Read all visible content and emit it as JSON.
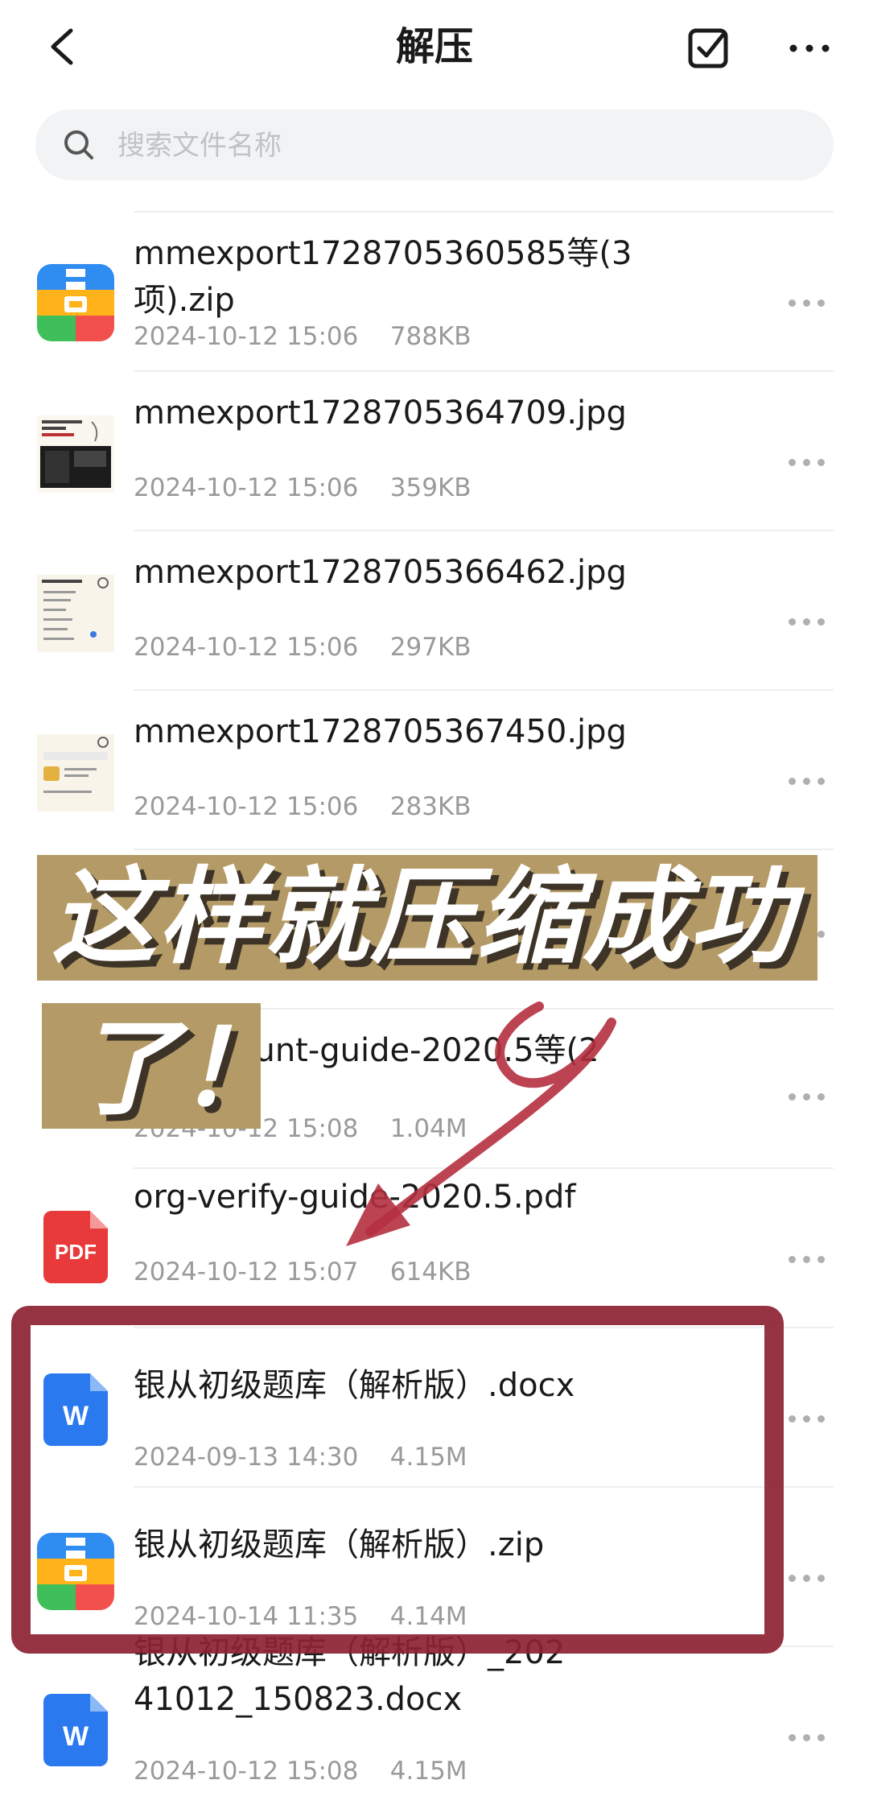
{
  "header": {
    "title": "解压"
  },
  "search": {
    "placeholder": "搜索文件名称"
  },
  "files": [
    {
      "name": "mmexport1728705360585等(3项).zip",
      "date": "2024-10-12 15:06",
      "size": "788KB",
      "icon": "zip-icon"
    },
    {
      "name": "mmexport1728705364709.jpg",
      "date": "2024-10-12 15:06",
      "size": "359KB",
      "icon": "image-thumbnail"
    },
    {
      "name": "mmexport1728705366462.jpg",
      "date": "2024-10-12 15:06",
      "size": "297KB",
      "icon": "image-thumbnail"
    },
    {
      "name": "mmexport1728705367450.jpg",
      "date": "2024-10-12 15:06",
      "size": "283KB",
      "icon": "image-thumbnail"
    },
    {
      "name": "ount-guide-2020.5等(2",
      "date": "2024-10-12 15:08",
      "size": "1.04M",
      "icon": "hidden"
    },
    {
      "name": "org-verify-guide-2020.5.pdf",
      "date": "2024-10-12 15:07",
      "size": "614KB",
      "icon": "pdf-icon"
    },
    {
      "name": "银从初级题库（解析版）.docx",
      "date": "2024-09-13 14:30",
      "size": "4.15M",
      "icon": "word-icon"
    },
    {
      "name": "银从初级题库（解析版）.zip",
      "date": "2024-10-14 11:35",
      "size": "4.14M",
      "icon": "zip-icon"
    },
    {
      "name": "银从初级题库（解析版）_20241012_150823.docx",
      "date": "2024-10-12 15:08",
      "size": "4.15M",
      "icon": "word-icon"
    }
  ],
  "overlay": {
    "line1": "这样就压缩成功",
    "line2": "了！",
    "banner_color": "#b49a66",
    "frame_color": "#8c2233",
    "arrow_color": "#b5303f"
  },
  "icons": {
    "pdf_label": "PDF",
    "word_label": "W"
  }
}
